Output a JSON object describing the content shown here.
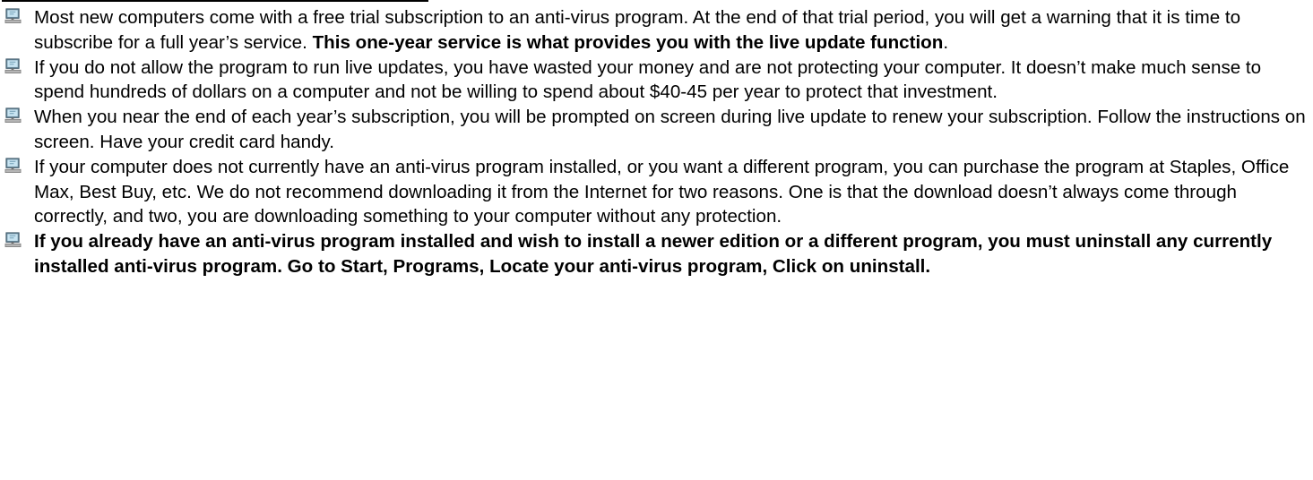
{
  "bullets": [
    {
      "icon": "computer-icon",
      "text": "Most new computers come with a free trial subscription to an anti-virus program. At the end of that trial period, you will get a warning that it is time to subscribe for a full year’s service. ",
      "bold_text": "This one-year service is what provides you with the live update function",
      "tail_text": "."
    },
    {
      "icon": "computer-icon",
      "text": "If you do not allow the program to run live updates, you have wasted your money and are not protecting your computer. It doesn’t make much sense to spend hundreds of dollars on a computer and not be willing to spend about $40-45 per year to protect that investment."
    },
    {
      "icon": "computer-icon",
      "text": "When you near the end of each year’s subscription, you will be prompted on screen during live update to renew your subscription. Follow the instructions on screen. Have your credit card handy."
    },
    {
      "icon": "computer-icon",
      "text": "If your computer does not currently have an anti-virus program installed, or you want a different program, you can purchase the program at Staples, Office Max, Best Buy, etc. We do not recommend downloading it from the Internet for two reasons. One is that the download doesn’t always come through correctly, and two, you are downloading something to your computer without any protection."
    },
    {
      "icon": "computer-icon",
      "bold_text": "If you already have an anti-virus program installed and wish to install a newer edition or a different program, you must uninstall any currently installed anti-virus program. Go to Start, Programs, Locate your anti-virus program, Click on uninstall."
    }
  ]
}
